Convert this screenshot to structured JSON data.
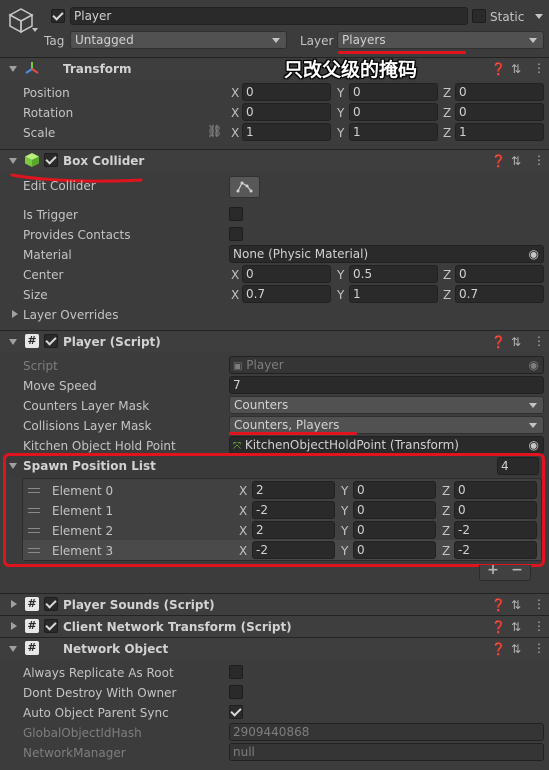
{
  "gameobject": {
    "name": "Player",
    "static_label": "Static",
    "tag_label": "Tag",
    "tag_value": "Untagged",
    "layer_label": "Layer",
    "layer_value": "Players"
  },
  "annotation": {
    "text": "只改父级的掩码",
    "color": "#e0141e"
  },
  "transform": {
    "title": "Transform",
    "rows": [
      {
        "label": "Position",
        "x": "0",
        "y": "0",
        "z": "0"
      },
      {
        "label": "Rotation",
        "x": "0",
        "y": "0",
        "z": "0"
      },
      {
        "label": "Scale",
        "x": "1",
        "y": "1",
        "z": "1"
      }
    ]
  },
  "box_collider": {
    "title": "Box Collider",
    "edit_collider": "Edit Collider",
    "is_trigger": "Is Trigger",
    "provides_contacts": "Provides Contacts",
    "material_label": "Material",
    "material_value": "None (Physic Material)",
    "center_label": "Center",
    "center": {
      "x": "0",
      "y": "0.5",
      "z": "0"
    },
    "size_label": "Size",
    "size": {
      "x": "0.7",
      "y": "1",
      "z": "0.7"
    },
    "layer_overrides": "Layer Overrides"
  },
  "player_script": {
    "title": "Player (Script)",
    "script_label": "Script",
    "script_value": "Player",
    "move_speed_label": "Move Speed",
    "move_speed_value": "7",
    "counters_mask_label": "Counters Layer Mask",
    "counters_mask_value": "Counters",
    "collisions_mask_label": "Collisions Layer Mask",
    "collisions_mask_value": "Counters, Players",
    "hold_point_label": "Kitchen Object Hold Point",
    "hold_point_value": "KitchenObjectHoldPoint (Transform)",
    "spawn_list_label": "Spawn Position List",
    "spawn_list_count": "4",
    "elements": [
      {
        "label": "Element 0",
        "x": "2",
        "y": "0",
        "z": "0"
      },
      {
        "label": "Element 1",
        "x": "-2",
        "y": "0",
        "z": "0"
      },
      {
        "label": "Element 2",
        "x": "2",
        "y": "0",
        "z": "-2"
      },
      {
        "label": "Element 3",
        "x": "-2",
        "y": "0",
        "z": "-2"
      }
    ],
    "add_symbol": "+",
    "remove_symbol": "−"
  },
  "player_sounds": {
    "title": "Player Sounds (Script)"
  },
  "client_network_transform": {
    "title": "Client Network Transform (Script)"
  },
  "network_object": {
    "title": "Network Object",
    "always_replicate": "Always Replicate As Root",
    "dont_destroy": "Dont Destroy With Owner",
    "auto_parent_sync": "Auto Object Parent Sync",
    "global_id_label": "GlobalObjectIdHash",
    "global_id_value": "2909440868",
    "network_manager_label": "NetworkManager",
    "network_manager_value": "null"
  },
  "axes": {
    "x": "X",
    "y": "Y",
    "z": "Z"
  }
}
